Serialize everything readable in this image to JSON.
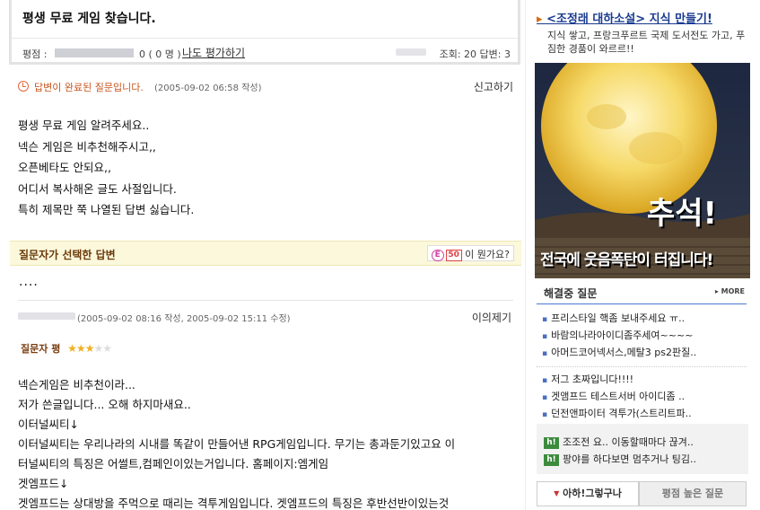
{
  "question": {
    "title": "평생 무료 게임 찾습니다.",
    "rating_label": "평점 :",
    "rating_count": "0 ( 0 명 )",
    "rate_link": "나도 평가하기",
    "stats": "조회: 20  답변: 3",
    "status": "답변이 완료된 질문입니다.",
    "date": "(2005-09-02 06:58 작성)",
    "report": "신고하기",
    "body": [
      "평생 무료 게임 알려주세요..",
      "넥슨 게임은 비추천해주시고,,",
      "오픈베타도 안되요,,",
      "어디서 복사해온 글도 사절입니다.",
      "특히 제목만 쭉 나열된 답변 싫습니다."
    ]
  },
  "selected_answer": {
    "header": "질문자가 선택한 답변",
    "badge_e": "E",
    "badge_num": "50",
    "badge_text": "이 뭔가요?",
    "dots": "....",
    "date": "(2005-09-02 08:16 작성, 2005-09-02 15:11 수정)",
    "objection": "이의제기",
    "asker_rating_label": "질문자 평",
    "stars": {
      "filled": 3,
      "total": 5
    },
    "body": [
      "넥슨게임은 비추천이라...",
      "저가 쓴글입니다... 오해 하지마새요..",
      "이터널씨티↓",
      "이터널씨티는 우리나라의 시내를 똑같이 만들어낸 RPG게임입니다. 무기는 총과둔기있고요 이",
      "터널씨티의 특징은 어썰트,컴페인이있는거입니다. 홈페이지:엠게임",
      "겟엠프드↓",
      "겟엠프드는 상대방을 주먹으로 때리는 격투게임입니다. 겟엠프드의 특징은 후반선반이있는것"
    ]
  },
  "sidebar": {
    "promo_title": "<조정래 대하소설> 지식 만들기!",
    "promo_desc": "지식 쌓고, 프랑크푸르트 국제 도서전도 가고, 푸짐한 경품이 와르르!!",
    "banner_big": "추석!",
    "banner_sub": "전국에 웃음폭탄이 터집니다!",
    "panel_title": "해결중 질문",
    "more": "▸ MORE",
    "list1": [
      "프리스타일 핵좀 보내주세요 ㅠ..",
      "바람의나라아이디좀주세여~~~~",
      "아머드코어넥서스,메탈3 ps2판질.."
    ],
    "list2": [
      "저그 초짜입니다!!!!",
      "겟앰프드 테스트서버 아이디좀 ..",
      "던전앤파이터 격투가(스트리트파.."
    ],
    "h_items": [
      {
        "icon": "h!",
        "text": "조조전 요.. 이동할때마다 끊겨.."
      },
      {
        "icon": "h!",
        "text": "팡야를 하다보면 멈추거나 팅김.."
      }
    ],
    "tab_active": "아하!그렇구나",
    "tab_inactive": "평점 높은 질문"
  },
  "colors": {
    "link_blue": "#1a3b90",
    "status_orange": "#c8541d",
    "star_gold": "#f0b020",
    "selected_bg": "#fbf8dc"
  }
}
